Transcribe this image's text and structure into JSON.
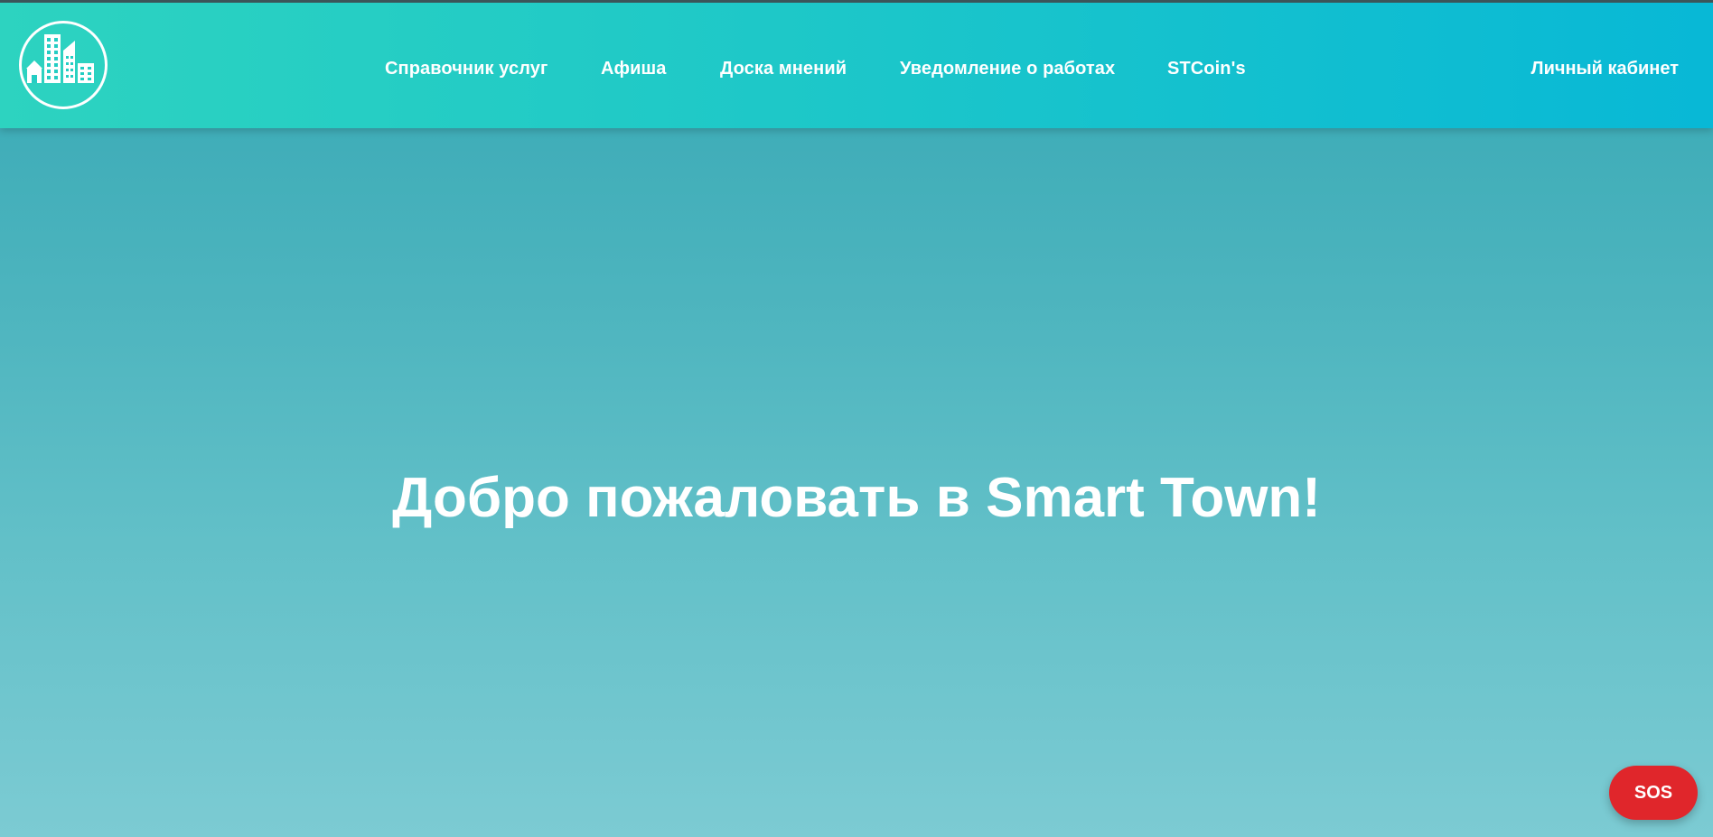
{
  "header": {
    "logo_icon": "city-buildings-icon",
    "nav": [
      {
        "label": "Справочник услуг"
      },
      {
        "label": "Афиша"
      },
      {
        "label": "Доска мнений"
      },
      {
        "label": "Уведомление о работах"
      },
      {
        "label": "STCoin's"
      }
    ],
    "account_label": "Личный кабинет"
  },
  "hero": {
    "title": "Добро пожаловать в Smart Town!"
  },
  "sos": {
    "label": "SOS"
  },
  "colors": {
    "header_gradient_start": "#2dd3c0",
    "header_gradient_end": "#08b8d6",
    "hero_gradient_top": "#36a8b4",
    "hero_gradient_bottom": "#7ccbd3",
    "sos_button": "#e0262b",
    "text": "#ffffff"
  }
}
